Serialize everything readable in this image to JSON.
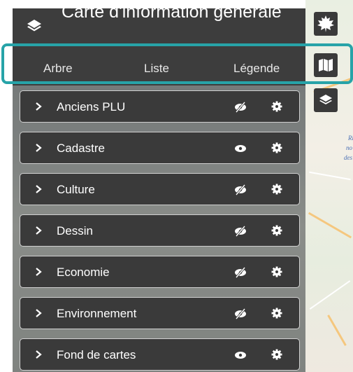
{
  "panel": {
    "title": "Carte d'information générale"
  },
  "tabs": [
    {
      "label": "Arbre"
    },
    {
      "label": "Liste"
    },
    {
      "label": "Légende"
    }
  ],
  "layers": [
    {
      "name": "Anciens PLU",
      "visible": false
    },
    {
      "name": "Cadastre",
      "visible": true
    },
    {
      "name": "Culture",
      "visible": false
    },
    {
      "name": "Dessin",
      "visible": false
    },
    {
      "name": "Economie",
      "visible": false
    },
    {
      "name": "Environnement",
      "visible": false
    },
    {
      "name": "Fond de cartes",
      "visible": true
    }
  ],
  "rail": {
    "icons": [
      "maple-leaf-icon",
      "map-icon",
      "layers-icon"
    ]
  },
  "map": {
    "labels": [
      "Ri",
      "no",
      "des"
    ]
  },
  "colors": {
    "panel_dark": "#3d3d3d",
    "row_bg": "#3a3a3a",
    "highlight": "#27a3a8"
  }
}
